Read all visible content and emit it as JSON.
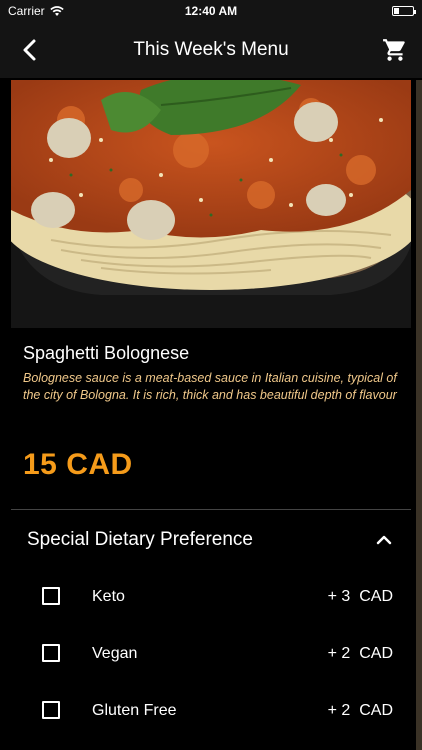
{
  "status_bar": {
    "carrier": "Carrier",
    "time": "12:40 AM",
    "battery_level": 0.25
  },
  "nav": {
    "title": "This Week's Menu",
    "back_icon": "chevron-left-icon",
    "cart_icon": "shopping-cart-icon"
  },
  "dish": {
    "image_icon": "spaghetti-bolognese-photo",
    "name": "Spaghetti Bolognese",
    "description": "Bolognese sauce is a meat-based sauce in Italian cuisine, typical of the city of Bologna. It is rich, thick and has beautiful depth of flavour",
    "price": "15  CAD"
  },
  "dietary_section": {
    "title": "Special Dietary Preference",
    "expanded": true,
    "options": [
      {
        "label": "Keto",
        "price": "+ 3  CAD",
        "checked": false
      },
      {
        "label": "Vegan",
        "price": "+ 2  CAD",
        "checked": false
      },
      {
        "label": "Gluten Free",
        "price": "+ 2  CAD",
        "checked": false
      }
    ]
  },
  "colors": {
    "accent": "#f59b1a",
    "description": "#f0c88a",
    "background": "#000000",
    "nav_background": "#141414"
  }
}
